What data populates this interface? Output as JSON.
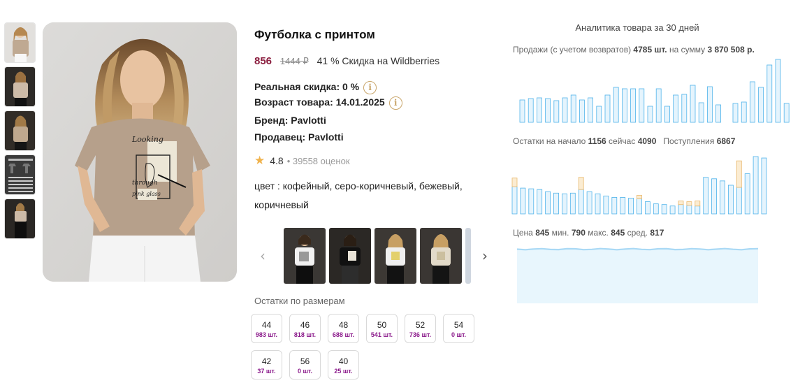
{
  "product": {
    "title": "Футболка с принтом",
    "price": "856",
    "old_price": "1444 ₽",
    "discount": "41 % Скидка на Wildberries",
    "real_discount": "Реальная скидка: 0 %",
    "age": "Возраст товара: 14.01.2025",
    "brand": "Бренд: Pavlotti",
    "seller": "Продавец: Pavlotti",
    "rating": "4.8",
    "reviews": "• 39558 оценок",
    "colors": "цвет : кофейный, серо-коричневый, бежевый, коричневый",
    "print_text": [
      "Looking",
      "through",
      "pink glass"
    ]
  },
  "sizes": {
    "label": "Остатки по размерам",
    "items": [
      {
        "size": "44",
        "qty": "983 шт."
      },
      {
        "size": "46",
        "qty": "818 шт."
      },
      {
        "size": "48",
        "qty": "688 шт."
      },
      {
        "size": "50",
        "qty": "541 шт."
      },
      {
        "size": "52",
        "qty": "736 шт."
      },
      {
        "size": "54",
        "qty": "0 шт."
      },
      {
        "size": "42",
        "qty": "37 шт."
      },
      {
        "size": "56",
        "qty": "0 шт."
      },
      {
        "size": "40",
        "qty": "25 шт."
      }
    ]
  },
  "analytics": {
    "title": "Аналитика товара за 30 дней",
    "sales": {
      "label": "Продажи (с учетом возвратов)",
      "count": "4785 шт.",
      "mid": "на сумму",
      "sum": "3 870 508 р."
    },
    "stock": {
      "start_label": "Остатки на начало",
      "start": "1156",
      "now_label": "сейчас",
      "now": "4090",
      "supply_label": "Поступления",
      "supply": "6867"
    },
    "price": {
      "label": "Цена",
      "current": "845",
      "min_label": "мин.",
      "min": "790",
      "max_label": "макс.",
      "max": "845",
      "avg_label": "сред.",
      "avg": "817"
    }
  },
  "chart_data": [
    {
      "type": "bar",
      "name": "sales",
      "values": [
        32,
        34,
        35,
        34,
        31,
        35,
        39,
        32,
        35,
        23,
        39,
        50,
        48,
        48,
        48,
        23,
        48,
        23,
        39,
        40,
        53,
        28,
        51,
        25,
        0,
        27,
        29,
        58,
        50,
        82,
        90,
        27
      ],
      "ylim": [
        0,
        90
      ],
      "color": "#4fb3ea"
    },
    {
      "type": "bar",
      "name": "stock",
      "values": [
        38,
        36,
        35,
        34,
        31,
        29,
        28,
        29,
        34,
        31,
        28,
        25,
        23,
        23,
        22,
        21,
        17,
        14,
        13,
        11,
        13,
        12,
        11,
        51,
        49,
        46,
        40,
        37,
        56,
        80,
        78
      ],
      "supply": [
        12,
        0,
        0,
        0,
        0,
        0,
        0,
        0,
        17,
        0,
        0,
        0,
        0,
        0,
        0,
        5,
        0,
        0,
        0,
        0,
        5,
        5,
        7,
        0,
        0,
        0,
        0,
        37,
        0,
        0,
        0
      ],
      "ylim": [
        0,
        80
      ],
      "color": "#4fb3ea",
      "supply_color": "#e9b96e"
    },
    {
      "type": "area",
      "name": "price",
      "values": [
        845,
        845,
        845,
        845,
        845,
        845,
        845,
        845,
        845,
        845,
        845,
        845,
        845,
        845,
        845,
        845,
        845,
        845,
        845,
        845,
        845,
        845,
        845,
        845,
        845,
        845,
        845,
        845,
        845,
        845
      ],
      "ylim": [
        790,
        850
      ],
      "color": "#4fb3ea"
    }
  ]
}
